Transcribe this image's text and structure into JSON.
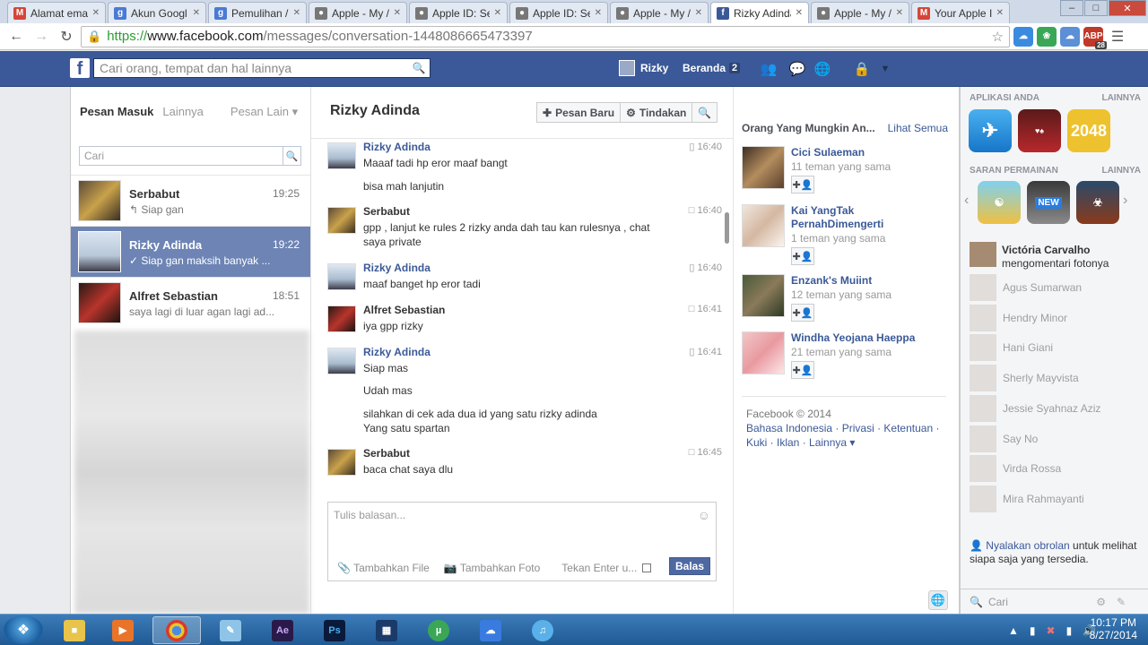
{
  "browser": {
    "tabs": [
      {
        "title": "Alamat ema",
        "icon": "gmail-icon",
        "color": "#d44638",
        "glyph": "M"
      },
      {
        "title": "Akun Googl",
        "icon": "google-icon",
        "color": "#4a7bd4",
        "glyph": "g"
      },
      {
        "title": "Pemulihan /",
        "icon": "google-icon",
        "color": "#4a7bd4",
        "glyph": "g"
      },
      {
        "title": "Apple - My /",
        "icon": "apple-icon",
        "color": "#777777",
        "glyph": "●"
      },
      {
        "title": "Apple ID: Se",
        "icon": "apple-icon",
        "color": "#777777",
        "glyph": "●"
      },
      {
        "title": "Apple ID: Se",
        "icon": "apple-icon",
        "color": "#777777",
        "glyph": "●"
      },
      {
        "title": "Apple - My /",
        "icon": "apple-icon",
        "color": "#777777",
        "glyph": "●"
      },
      {
        "title": "Rizky Adinda",
        "icon": "facebook-icon",
        "color": "#3b5998",
        "glyph": "f",
        "active": true
      },
      {
        "title": "Apple - My /",
        "icon": "apple-icon",
        "color": "#777777",
        "glyph": "●"
      },
      {
        "title": "Your Apple I",
        "icon": "gmail-icon",
        "color": "#d44638",
        "glyph": "M"
      }
    ],
    "url_scheme": "https://",
    "url_host": "www.facebook.com",
    "url_path": "/messages/conversation-1448086665473397",
    "ext_badge": "28"
  },
  "fb": {
    "search_placeholder": "Cari orang, tempat dan hal lainnya",
    "user_name": "Rizky",
    "home_label": "Beranda",
    "home_count": "2"
  },
  "inbox": {
    "tab_inbox": "Pesan Masuk",
    "tab_more": "Lainnya",
    "tab_other": "Pesan Lain ▾",
    "search_placeholder": "Cari",
    "threads": [
      {
        "name": "Serbabut",
        "time": "19:25",
        "snippet": "↰ Siap gan"
      },
      {
        "name": "Rizky Adinda",
        "time": "19:22",
        "snippet": "✓ Siap gan maksih banyak ..."
      },
      {
        "name": "Alfret Sebastian",
        "time": "18:51",
        "snippet": "saya lagi di luar agan lagi ad..."
      }
    ]
  },
  "conversation": {
    "title": "Rizky Adinda",
    "btn_new": "Pesan Baru",
    "btn_actions": "Tindakan",
    "messages": [
      {
        "name": "Rizky Adinda",
        "time": "16:40",
        "lines": [
          "Maaaf tadi hp eror maaf bangt",
          "bisa mah lanjutin"
        ]
      },
      {
        "name": "Serbabut",
        "time": "16:40",
        "lines": [
          "gpp , lanjut ke rules 2 rizky anda dah tau kan rulesnya , chat",
          "saya private"
        ]
      },
      {
        "name": "Rizky Adinda",
        "time": "16:40",
        "lines": [
          "maaf banget hp eror tadi"
        ]
      },
      {
        "name": "Alfret Sebastian",
        "time": "16:41",
        "lines": [
          "iya gpp rizky"
        ]
      },
      {
        "name": "Rizky Adinda",
        "time": "16:41",
        "lines": [
          "Siap mas",
          "Udah mas",
          "silahkan di cek ada dua id yang satu rizky adinda",
          "Yang satu spartan"
        ]
      },
      {
        "name": "Serbabut",
        "time": "16:45",
        "lines": [
          "baca chat saya dlu"
        ]
      }
    ],
    "composer_placeholder": "Tulis balasan...",
    "add_file": "Tambahkan File",
    "add_photo": "Tambahkan Foto",
    "press_enter": "Tekan Enter u...",
    "reply": "Balas"
  },
  "pymk": {
    "title": "Orang Yang Mungkin An...",
    "see_all": "Lihat Semua",
    "people": [
      {
        "name": "Cici Sulaeman",
        "mutual": "11 teman yang sama"
      },
      {
        "name": "Kai YangTak PernahDimengerti",
        "mutual": "1 teman yang sama"
      },
      {
        "name": "Enzank's Muiint",
        "mutual": "12 teman yang sama"
      },
      {
        "name": "Windha Yeojana Haeppa",
        "mutual": "21 teman yang sama"
      }
    ]
  },
  "footer": {
    "copyright": "Facebook © 2014",
    "line1": "Bahasa Indonesia · Privasi · Ketentuan ·",
    "line2": "Kuki · Iklan · Lainnya ▾"
  },
  "sidebar": {
    "apps_title": "APLIKASI ANDA",
    "apps_more": "LAINNYA",
    "app_badge": "1",
    "app_2048": "2048",
    "games_title": "SARAN PERMAINAN",
    "games_more": "LAINNYA",
    "game_new": "NEW",
    "activity_name": "Victória Carvalho",
    "activity_action": "mengomentari fotonya",
    "friends": [
      "Agus Sumarwan",
      "Hendry Minor",
      "Hani Giani",
      "Sherly Mayvista",
      "Jessie Syahnaz Aziz",
      "Say No",
      "Virda Rossa",
      "Mira Rahmayanti"
    ],
    "chat_link": "Nyalakan obrolan",
    "chat_rest": " untuk melihat siapa saja yang tersedia.",
    "search_placeholder": "Cari"
  },
  "taskbar": {
    "time": "10:17 PM",
    "date": "8/27/2014"
  }
}
